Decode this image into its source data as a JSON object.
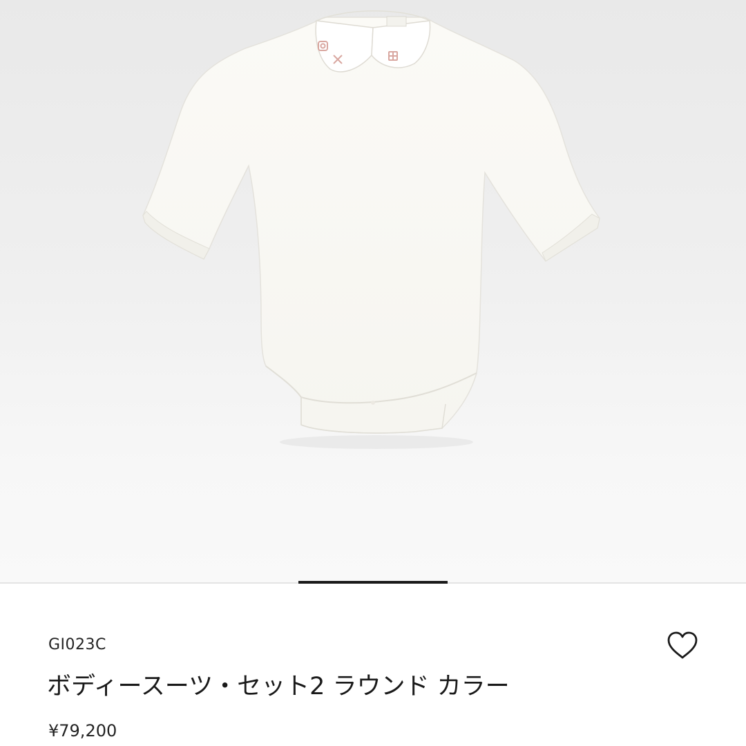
{
  "product": {
    "sku": "GI023C",
    "name": "ボディースーツ・セット2 ラウンド カラー",
    "price": "¥79,200",
    "image": {
      "icon": "baby-bodysuit-image",
      "embroidery_color": "#d9a7a0"
    }
  },
  "carousel": {
    "active_index": 1,
    "indicator_color": "#1a1a1a"
  },
  "actions": {
    "wishlist_icon": "heart-outline-icon"
  }
}
